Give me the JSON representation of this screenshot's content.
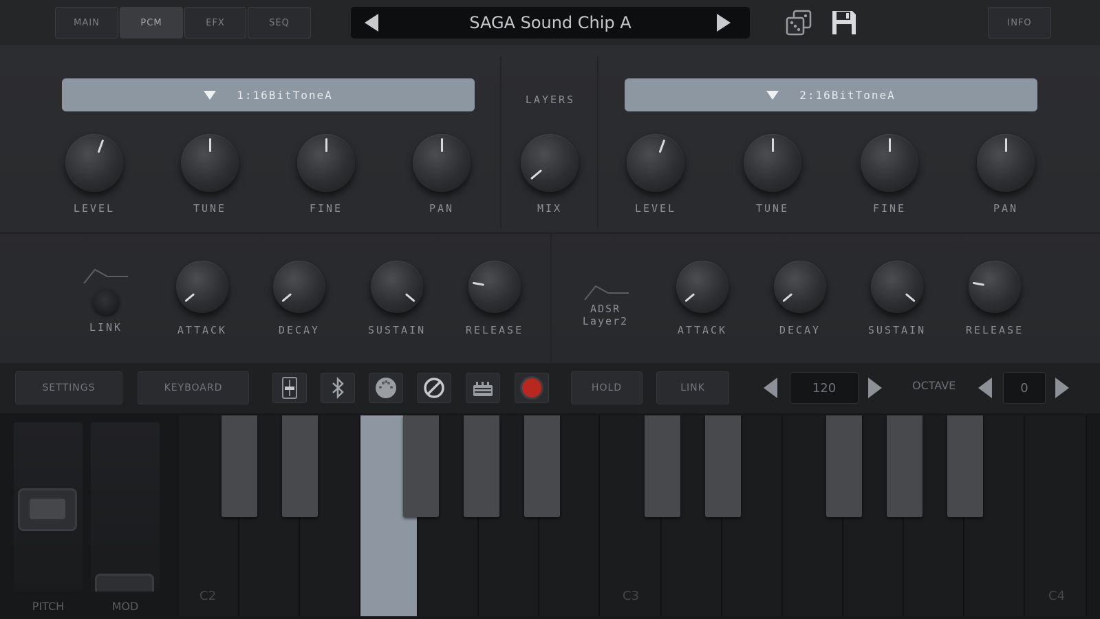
{
  "topbar": {
    "tabs": [
      {
        "label": "MAIN",
        "active": false
      },
      {
        "label": "PCM",
        "active": true
      },
      {
        "label": "EFX",
        "active": false
      },
      {
        "label": "SEQ",
        "active": false
      }
    ],
    "preset_name": "SAGA Sound Chip A",
    "info_label": "INFO",
    "icons": {
      "prev": "triangle-left-icon",
      "next": "triangle-right-icon",
      "random": "dice-icon",
      "save": "floppy-disk-icon"
    }
  },
  "layers": {
    "label": "LAYERS",
    "layer1": {
      "wave": "1:16BitToneA",
      "knobs": [
        {
          "label": "LEVEL",
          "angle": 20
        },
        {
          "label": "TUNE",
          "angle": 0
        },
        {
          "label": "FINE",
          "angle": 0
        },
        {
          "label": "PAN",
          "angle": 0
        }
      ]
    },
    "mix": {
      "label": "MIX",
      "angle": -130
    },
    "layer2": {
      "wave": "2:16BitToneA",
      "knobs": [
        {
          "label": "LEVEL",
          "angle": 20
        },
        {
          "label": "TUNE",
          "angle": 0
        },
        {
          "label": "FINE",
          "angle": 0
        },
        {
          "label": "PAN",
          "angle": 0
        }
      ]
    }
  },
  "envelopes": {
    "link_label": "LINK",
    "adsr_label_1": "ADSR",
    "adsr_label_2": "Layer2",
    "env1": [
      {
        "label": "ATTACK",
        "angle": -130
      },
      {
        "label": "DECAY",
        "angle": -130
      },
      {
        "label": "SUSTAIN",
        "angle": 130
      },
      {
        "label": "RELEASE",
        "angle": -80
      }
    ],
    "env2": [
      {
        "label": "ATTACK",
        "angle": -130
      },
      {
        "label": "DECAY",
        "angle": -130
      },
      {
        "label": "SUSTAIN",
        "angle": 130
      },
      {
        "label": "RELEASE",
        "angle": -80
      }
    ]
  },
  "toolbar": {
    "settings_label": "SETTINGS",
    "keyboard_label": "KEYBOARD",
    "hold_label": "HOLD",
    "link_label": "LINK",
    "tempo_value": "120",
    "octave_label": "OCTAVE",
    "octave_value": "0",
    "record_color": "#b8281e",
    "icons": [
      "slider-icon",
      "bluetooth-icon",
      "midi-icon",
      "disable-icon",
      "audio-interface-icon",
      "record-icon"
    ]
  },
  "keyboard": {
    "pitch_label": "PITCH",
    "mod_label": "MOD",
    "key_labels": [
      "C2",
      "C3",
      "C4"
    ],
    "pressed_key": "E2"
  }
}
